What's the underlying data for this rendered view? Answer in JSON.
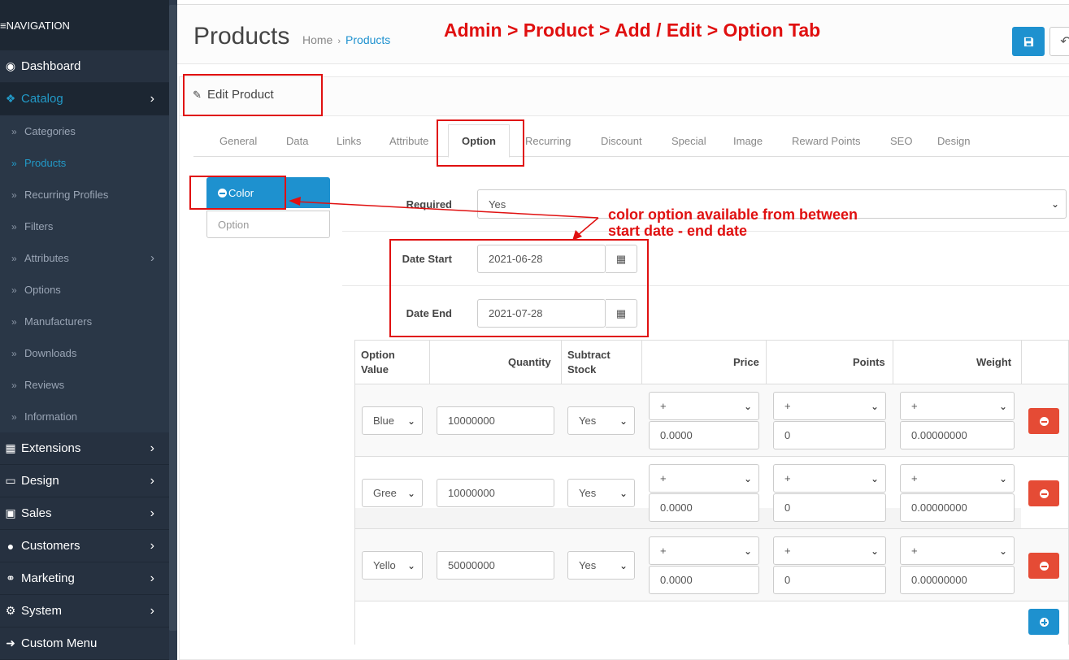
{
  "sidebar": {
    "header": "≡NAVIGATION",
    "items": [
      {
        "label": "Dashboard",
        "icon": "dashboard-icon",
        "arrow": false
      },
      {
        "label": "Catalog",
        "icon": "tag-icon",
        "arrow": true,
        "active": true
      },
      {
        "label": "Extensions",
        "icon": "puzzle-icon",
        "arrow": true
      },
      {
        "label": "Design",
        "icon": "desktop-icon",
        "arrow": true
      },
      {
        "label": "Sales",
        "icon": "cart-icon",
        "arrow": true
      },
      {
        "label": "Customers",
        "icon": "user-icon",
        "arrow": true
      },
      {
        "label": "Marketing",
        "icon": "share-icon",
        "arrow": true
      },
      {
        "label": "System",
        "icon": "gear-icon",
        "arrow": true
      },
      {
        "label": "Custom Menu",
        "icon": "arrow-right-icon",
        "arrow": false
      }
    ],
    "catalog_sub": [
      {
        "label": "Categories"
      },
      {
        "label": "Products",
        "active": true
      },
      {
        "label": "Recurring Profiles"
      },
      {
        "label": "Filters"
      },
      {
        "label": "Attributes",
        "arrow": true
      },
      {
        "label": "Options"
      },
      {
        "label": "Manufacturers"
      },
      {
        "label": "Downloads"
      },
      {
        "label": "Reviews"
      },
      {
        "label": "Information"
      }
    ]
  },
  "header": {
    "title": "Products",
    "breadcrumb": [
      "Home",
      "Products"
    ],
    "annotation": "Admin > Product > Add / Edit > Option Tab"
  },
  "panel": {
    "title": "Edit Product",
    "tabs": [
      "General",
      "Data",
      "Links",
      "Attribute",
      "Option",
      "Recurring",
      "Discount",
      "Special",
      "Image",
      "Reward Points",
      "SEO",
      "Design"
    ],
    "active_tab": "Option"
  },
  "option_list": {
    "selected": "Color",
    "input_placeholder": "Option"
  },
  "form": {
    "required_label": "Required",
    "required_value": "Yes",
    "date_start_label": "Date Start",
    "date_start": "2021-06-28",
    "date_end_label": "Date End",
    "date_end": "2021-07-28",
    "annotation_line1": "color option available from between",
    "annotation_line2": "start date - end date"
  },
  "table": {
    "headers": {
      "option_value_1": "Option",
      "option_value_2": "Value",
      "quantity": "Quantity",
      "subtract_1": "Subtract",
      "subtract_2": "Stock",
      "price": "Price",
      "points": "Points",
      "weight": "Weight"
    },
    "rows": [
      {
        "value": "Blue",
        "quantity": "10000000",
        "subtract": "Yes",
        "price_prefix": "+",
        "price": "0.0000",
        "points_prefix": "+",
        "points": "0",
        "weight_prefix": "+",
        "weight": "0.00000000"
      },
      {
        "value": "Gree",
        "quantity": "10000000",
        "subtract": "Yes",
        "price_prefix": "+",
        "price": "0.0000",
        "points_prefix": "+",
        "points": "0",
        "weight_prefix": "+",
        "weight": "0.00000000"
      },
      {
        "value": "Yello",
        "quantity": "50000000",
        "subtract": "Yes",
        "price_prefix": "+",
        "price": "0.0000",
        "points_prefix": "+",
        "points": "0",
        "weight_prefix": "+",
        "weight": "0.00000000"
      }
    ]
  },
  "colors": {
    "primary": "#1e91cf",
    "danger": "#e54b35",
    "annotation": "#e01010",
    "sidebar": "#263140"
  }
}
